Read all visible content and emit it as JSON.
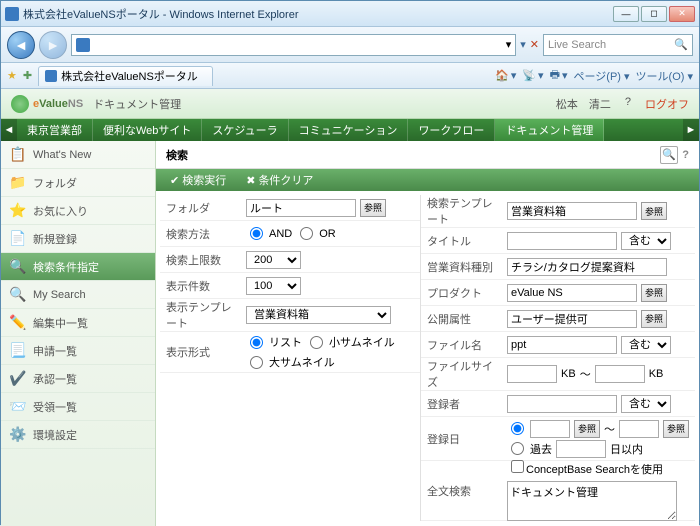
{
  "window": {
    "title": "株式会社eValueNSポータル - Windows Internet Explorer"
  },
  "browser": {
    "refresh_dd": "▾",
    "live_search": "Live Search",
    "tab_title": "株式会社eValueNSポータル",
    "tools": {
      "home": "▾",
      "feed": "▾",
      "print": "▾",
      "page": "ページ(P) ▾",
      "tool": "ツール(O) ▾"
    }
  },
  "app": {
    "logo_e": "e",
    "logo_value": "Value",
    "logo_ns": "NS",
    "logo_sub": "ドキュメント管理",
    "user": "松本　清二",
    "help": "?",
    "logout": "ログオフ"
  },
  "menu": {
    "items": [
      "東京営業部",
      "便利なWebサイト",
      "スケジューラ",
      "コミュニケーション",
      "ワークフロー",
      "ドキュメント管理"
    ],
    "active": 5
  },
  "sidebar": {
    "items": [
      {
        "icon": "📋",
        "label": "What's New"
      },
      {
        "icon": "📁",
        "label": "フォルダ"
      },
      {
        "icon": "⭐",
        "label": "お気に入り"
      },
      {
        "icon": "📄",
        "label": "新規登録"
      },
      {
        "icon": "🔍",
        "label": "検索条件指定"
      },
      {
        "icon": "🔍",
        "label": "My Search"
      },
      {
        "icon": "✏️",
        "label": "編集中一覧"
      },
      {
        "icon": "📃",
        "label": "申請一覧"
      },
      {
        "icon": "✔️",
        "label": "承認一覧"
      },
      {
        "icon": "📨",
        "label": "受領一覧"
      },
      {
        "icon": "⚙️",
        "label": "環境設定"
      }
    ],
    "active": 4
  },
  "page": {
    "title": "検索"
  },
  "actions": {
    "exec": "検索実行",
    "clear": "条件クリア"
  },
  "left": {
    "folder": {
      "label": "フォルダ",
      "value": "ルート",
      "ref": "参照"
    },
    "method": {
      "label": "検索方法",
      "and": "AND",
      "or": "OR"
    },
    "limit": {
      "label": "検索上限数",
      "value": "200"
    },
    "display": {
      "label": "表示件数",
      "value": "100"
    },
    "template": {
      "label": "表示テンプレート",
      "value": "営業資料箱"
    },
    "format": {
      "label": "表示形式",
      "list": "リスト",
      "small": "小サムネイル",
      "large": "大サムネイル"
    }
  },
  "right": {
    "tmpl": {
      "label": "検索テンプレート",
      "value": "営業資料箱",
      "ref": "参照"
    },
    "title": {
      "label": "タイトル",
      "value": "",
      "contain": "含む"
    },
    "type": {
      "label": "営業資料種別",
      "value": "チラシ/カタログ提案資料"
    },
    "product": {
      "label": "プロダクト",
      "value": "eValue NS",
      "ref": "参照"
    },
    "public": {
      "label": "公開属性",
      "value": "ユーザー提供可",
      "ref": "参照"
    },
    "filename": {
      "label": "ファイル名",
      "value": "ppt",
      "contain": "含む"
    },
    "filesize": {
      "label": "ファイルサイズ",
      "unit": "KB",
      "sep": "～"
    },
    "registrant": {
      "label": "登録者",
      "value": "",
      "contain": "含む"
    },
    "regdate": {
      "label": "登録日",
      "past": "過去",
      "days": "日以内",
      "ref": "参照"
    },
    "fulltext": {
      "label": "全文検索",
      "cb": "ConceptBase Searchを使用",
      "value": "ドキュメント管理"
    }
  }
}
